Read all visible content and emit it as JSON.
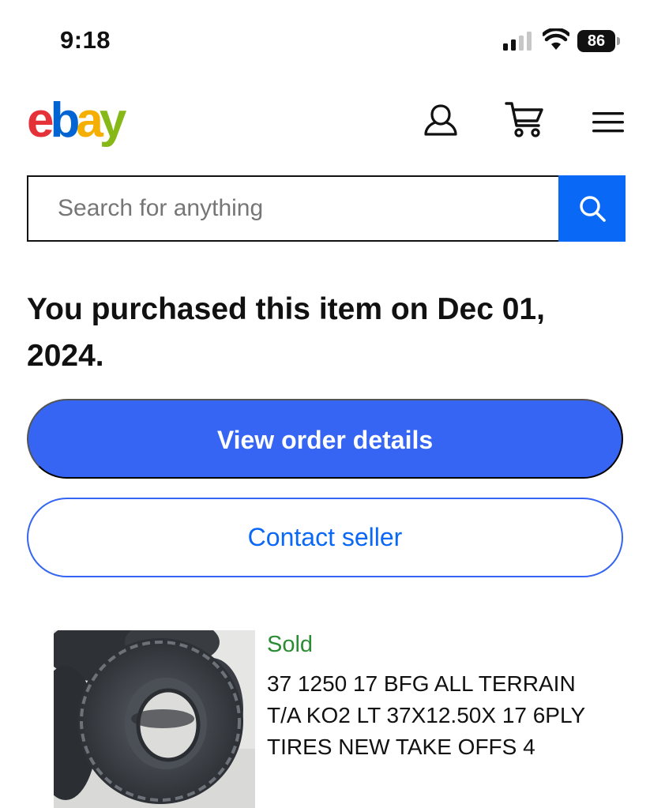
{
  "status_bar": {
    "time": "9:18",
    "battery_level": "86",
    "icons": [
      "signal-icon",
      "wifi-icon",
      "battery-icon"
    ]
  },
  "header": {
    "logo_letters": [
      "e",
      "b",
      "a",
      "y"
    ],
    "logo_colors": [
      "#e53238",
      "#0064d2",
      "#f5af02",
      "#86b817"
    ],
    "icons": [
      "account-icon",
      "cart-icon",
      "menu-icon"
    ]
  },
  "search": {
    "placeholder": "Search for anything",
    "value": "",
    "button_icon": "search-icon",
    "button_color": "#0968f6"
  },
  "purchase": {
    "message": "You purchased this item on Dec 01, 2024.",
    "view_order_label": "View order details",
    "contact_seller_label": "Contact seller",
    "primary_color": "#3665f3"
  },
  "item": {
    "status": "Sold",
    "status_color": "#2c8c35",
    "title": "37 1250 17 BFG ALL TERRAIN T/A KO2 LT 37X12.50X 17 6PLY TIRES NEW TAKE OFFS 4",
    "image": "tire-stack-photo"
  }
}
